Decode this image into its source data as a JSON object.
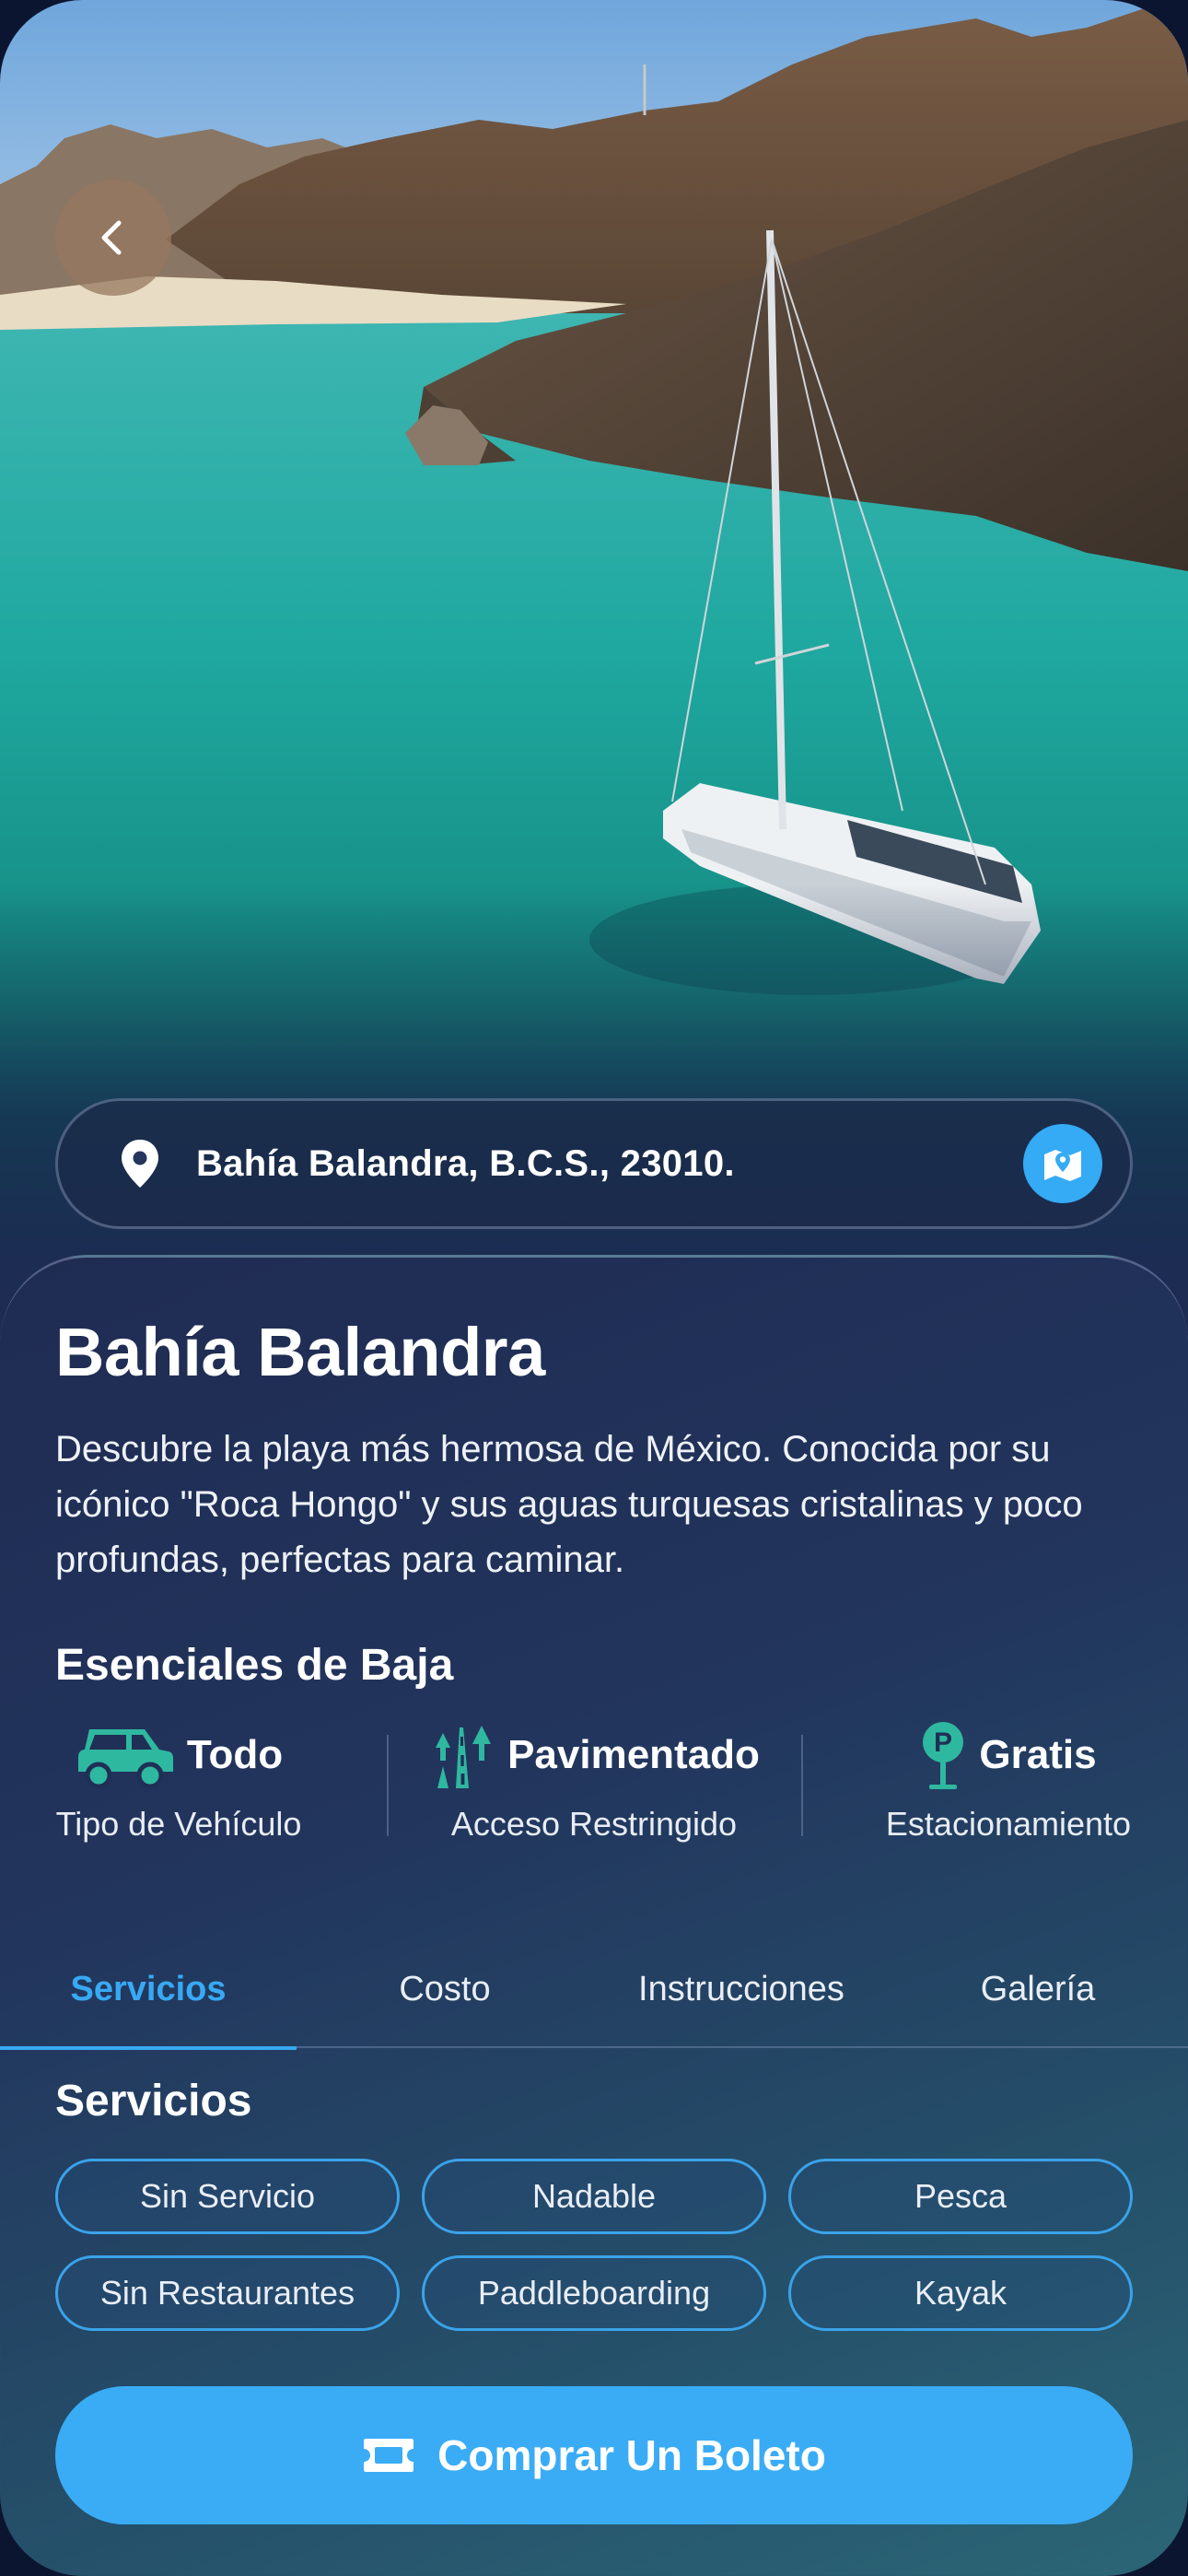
{
  "location": {
    "address": "Bahía Balandra, B.C.S., 23010."
  },
  "place": {
    "title": "Bahía Balandra",
    "description": "Descubre la playa más hermosa de México. Conocida por su icónico \"Roca Hongo\" y sus aguas turquesas cristalinas y poco profundas, perfectas para caminar."
  },
  "essentials": {
    "title": "Esenciales de Baja",
    "items": [
      {
        "icon": "car-icon",
        "value": "Todo",
        "label": "Tipo de Vehículo"
      },
      {
        "icon": "road-trees-icon",
        "value": "Pavimentado",
        "label": "Acceso Restringido"
      },
      {
        "icon": "parking-icon",
        "value": "Gratis",
        "label": "Estacionamiento"
      }
    ]
  },
  "tabs": [
    {
      "label": "Servicios",
      "active": true
    },
    {
      "label": "Costo",
      "active": false
    },
    {
      "label": "Instrucciones",
      "active": false
    },
    {
      "label": "Galería",
      "active": false
    }
  ],
  "services": {
    "title": "Servicios",
    "chips": [
      "Sin Servicio",
      "Nadable",
      "Pesca",
      "Sin Restaurantes",
      "Paddleboarding",
      "Kayak"
    ]
  },
  "cta": {
    "label": "Comprar Un Boleto",
    "icon": "ticket-icon"
  },
  "colors": {
    "accent": "#38a9f4",
    "sheet": "#1f2b52",
    "essential_icon": "#2fb8a0"
  }
}
